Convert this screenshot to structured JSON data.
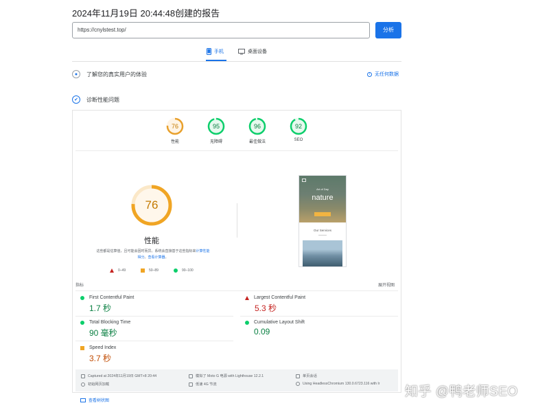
{
  "report": {
    "title": "2024年11月19日 20:44:48创建的报告"
  },
  "search": {
    "url": "https://cnylstest.top/",
    "analyze_label": "分析"
  },
  "tabs": [
    {
      "label": "手机",
      "icon": "phone-icon",
      "active": true
    },
    {
      "label": "桌面设备",
      "icon": "desktop-icon",
      "active": false
    }
  ],
  "field_data": {
    "label": "了解您的真实用户的体验",
    "no_data_label": "无任何数据"
  },
  "diagnose": {
    "label": "诊断性能问题"
  },
  "categories": [
    {
      "label": "性能",
      "score": 76,
      "color": "#e8a02b"
    },
    {
      "label": "无障碍",
      "score": 95,
      "color": "#0cce6b"
    },
    {
      "label": "最佳做法",
      "score": 96,
      "color": "#0cce6b"
    },
    {
      "label": "SEO",
      "score": 92,
      "color": "#0cce6b"
    }
  ],
  "performance": {
    "score": 76,
    "label": "性能",
    "desc_line1": "这些都是估算值，且可能会因时而异。系统会直接基于这些指标来",
    "desc_link1": "计算性能",
    "desc_line2": "得分",
    "desc_mid": "。",
    "desc_link2": "查看计算器",
    "desc_end": "。",
    "legend": [
      {
        "range": "0–49",
        "shape": "triangle",
        "color": "#c5221f"
      },
      {
        "range": "50–89",
        "shape": "square",
        "color": "#f0a524"
      },
      {
        "range": "90–100",
        "shape": "circle",
        "color": "#0cce6b"
      }
    ]
  },
  "screenshot": {
    "heading_small": "Art of Day",
    "heading_big": "nature",
    "services": "Our Services"
  },
  "metrics": {
    "header": "指标",
    "expand_label": "展开视图",
    "items": [
      {
        "name": "First Contentful Paint",
        "value": "1.7 秒",
        "status": "good",
        "color": "#0b8043"
      },
      {
        "name": "Largest Contentful Paint",
        "value": "5.3 秒",
        "status": "poor",
        "color": "#c5221f"
      },
      {
        "name": "Total Blocking Time",
        "value": "90 毫秒",
        "status": "good",
        "color": "#0b8043"
      },
      {
        "name": "Cumulative Layout Shift",
        "value": "0.09",
        "status": "good",
        "color": "#0b8043"
      },
      {
        "name": "Speed Index",
        "value": "3.7 秒",
        "status": "average",
        "color": "#c04a00"
      }
    ]
  },
  "environment": {
    "captured": "Captured at 2024年11月19日 GMT+8 20:44",
    "initial_load": "初始网页加载",
    "emulated": "模拟了 Moto G 电源 with Lighthouse 12.2.1",
    "throttling": "低速 4G 节流",
    "single_session": "单页会话",
    "browser": "Using HeadlessChromium 130.0.6723.116 with lr"
  },
  "treemap": {
    "label": "查看树状图"
  },
  "watermark": {
    "text": "知乎 @鸭老师SEO"
  }
}
